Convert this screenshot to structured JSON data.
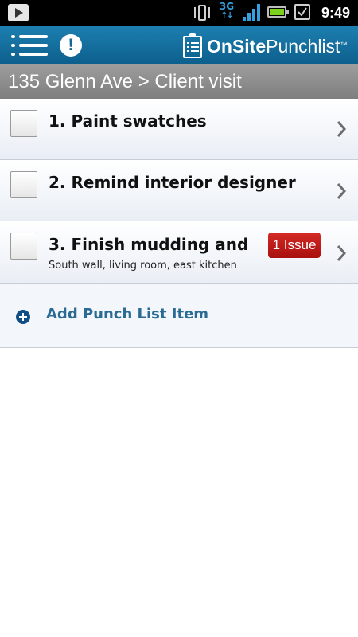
{
  "status_bar": {
    "time": "9:49",
    "network": "3G",
    "icons": [
      "play-store-icon",
      "vibrate-icon",
      "3g-icon",
      "signal-icon",
      "battery-icon",
      "checkmark-notification-icon"
    ],
    "colors": {
      "network": "#35a0e0",
      "battery": "#7bd11e"
    }
  },
  "header": {
    "brand_bold": "OnSite",
    "brand_regular": "Punchlist",
    "brand_tm": "™",
    "icons": [
      "menu-list-icon",
      "alert-icon",
      "clipboard-logo-icon"
    ],
    "alert_glyph": "!",
    "colors": {
      "bar": "#1577a8"
    }
  },
  "breadcrumb": "135 Glenn Ave > Client visit",
  "items": [
    {
      "title": "1. Paint swatches",
      "subtitle": "",
      "badge": ""
    },
    {
      "title": "2. Remind interior designer",
      "subtitle": "",
      "badge": ""
    },
    {
      "title": "3. Finish mudding and",
      "subtitle": "South wall, living room, east kitchen",
      "badge": "1 Issue"
    }
  ],
  "add_item": {
    "label": "Add Punch List Item",
    "icon": "plus-circle-icon"
  },
  "colors": {
    "badge": "#c01d1a",
    "add_label": "#2a6a93"
  }
}
